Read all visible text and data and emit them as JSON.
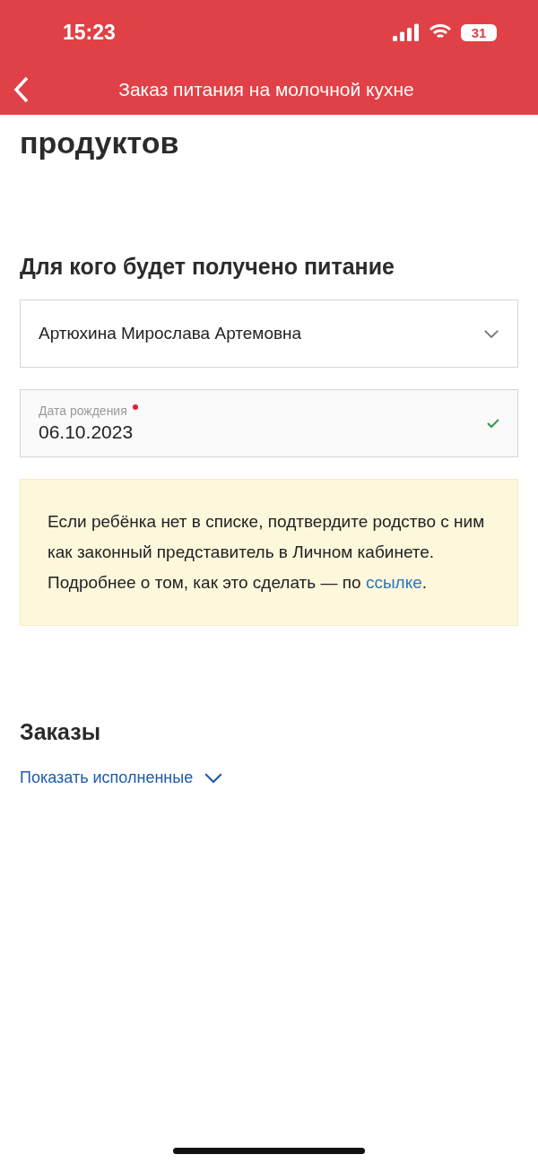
{
  "status_bar": {
    "time": "15:23",
    "battery": "31"
  },
  "nav": {
    "title": "Заказ питания на молочной кухне"
  },
  "heading": "продуктов",
  "recipient": {
    "title": "Для кого будет получено питание",
    "select": {
      "value": "Артюхина Мирослава Артемовна",
      "expanded": false
    },
    "birth_date": {
      "label": "Дата рождения",
      "required": true,
      "value": "06.10.2023",
      "valid": true
    }
  },
  "notice": {
    "text": "Если ребёнка нет в списке, подтвердите родство с ним как законный представитель в Личном кабинете. Подробнее о том, как это сделать — по ",
    "link": "ссылке",
    "after": "."
  },
  "orders": {
    "title": "Заказы",
    "toggle": {
      "label": "Показать исполненные",
      "expanded": false
    }
  }
}
